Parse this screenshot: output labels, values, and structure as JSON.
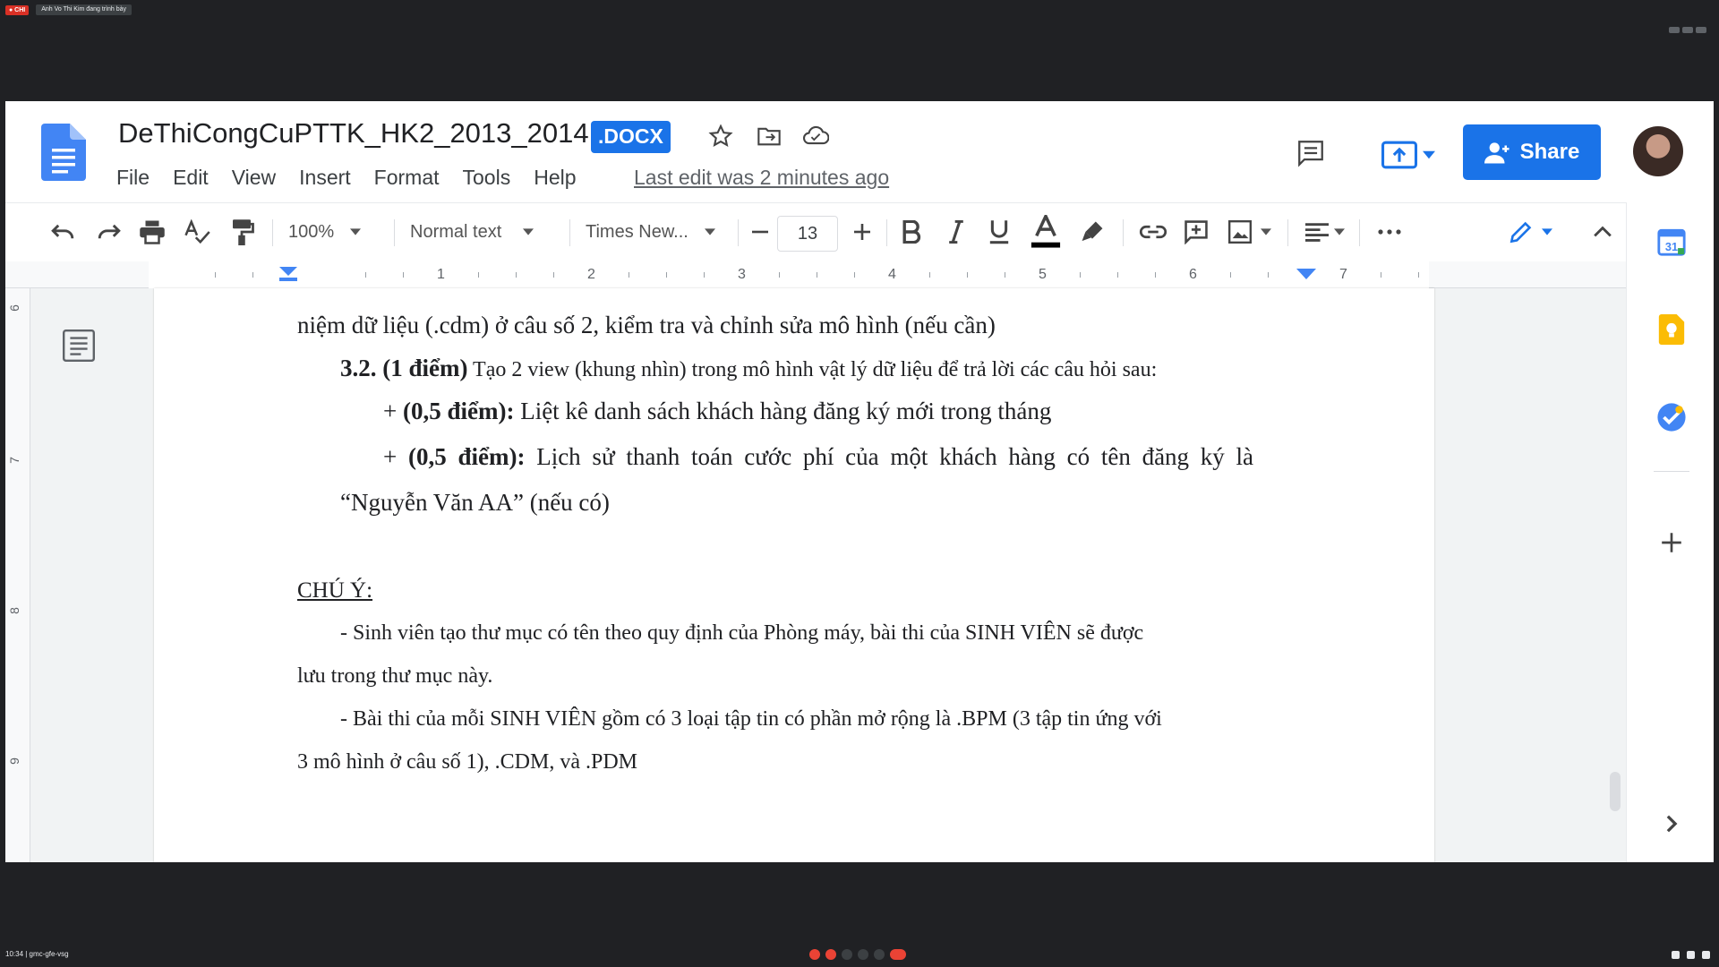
{
  "meet": {
    "rec_label": "● CHI",
    "presenter_label": "Anh Vo Thi Kim đang trình bày",
    "clock_label": "10:34  |  gmc-gfe-vsg"
  },
  "docs": {
    "title": "DeThiCongCuPTTK_HK2_2013_2014",
    "badge": ".DOCX",
    "menu": [
      "File",
      "Edit",
      "View",
      "Insert",
      "Format",
      "Tools",
      "Help"
    ],
    "last_edit": "Last edit was 2 minutes ago",
    "share_label": "Share",
    "toolbar": {
      "zoom": "100%",
      "style": "Normal text",
      "font": "Times New...",
      "font_size": "13"
    },
    "ruler_numbers": [
      "1",
      "2",
      "3",
      "4",
      "5",
      "6",
      "7"
    ],
    "vruler_numbers": [
      "6",
      "7",
      "8",
      "9"
    ]
  },
  "document": {
    "line1": "niệm dữ liệu (.cdm) ở câu số 2, kiểm tra và chỉnh sửa mô hình (nếu cần)",
    "q32_bold": "3.2. (1 điểm)",
    "q32_rest": " Tạo 2 view (khung nhìn) trong mô hình vật lý dữ liệu để trả lời các câu hỏi sau:",
    "item1_prefix": "+ ",
    "item1_bold": "(0,5 điểm):",
    "item1_rest": " Liệt kê danh sách khách hàng đăng ký mới trong tháng",
    "item2_prefix": "+ ",
    "item2_bold": "(0,5 điểm):",
    "item2_rest": " Lịch sử thanh toán cước phí của một khách hàng có tên đăng ký là",
    "item2_cont": "“Nguyễn Văn AA” (nếu có)",
    "note_heading": "CHÚ Ý:",
    "note1_a": "- Sinh viên tạo thư mục có tên theo quy định của Phòng máy, bài thi của SINH VIÊN sẽ được",
    "note1_b": "lưu trong thư mục này.",
    "note2_a": "- Bài thi của mỗi SINH VIÊN gồm có 3 loại tập tin có phần mở rộng là .BPM (3 tập tin ứng với",
    "note2_b": "3 mô hình ở câu số 1), .CDM, và .PDM"
  },
  "colors": {
    "accent": "#1a73e8",
    "meet_bg": "#202124"
  }
}
